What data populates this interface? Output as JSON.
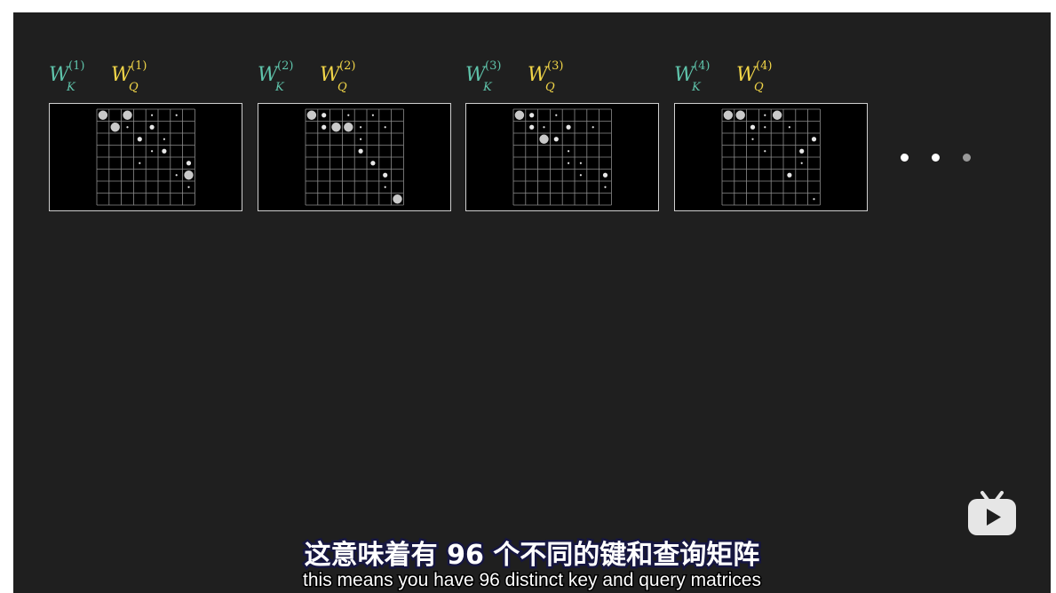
{
  "heads": [
    {
      "k_symbol": "W",
      "k_sub": "K",
      "k_sup": "(1)",
      "q_symbol": "W",
      "q_sub": "Q",
      "q_sup": "(1)"
    },
    {
      "k_symbol": "W",
      "k_sub": "K",
      "k_sup": "(2)",
      "q_symbol": "W",
      "q_sub": "Q",
      "q_sup": "(2)"
    },
    {
      "k_symbol": "W",
      "k_sub": "K",
      "k_sup": "(3)",
      "q_symbol": "W",
      "q_sub": "Q",
      "q_sup": "(3)"
    },
    {
      "k_symbol": "W",
      "k_sub": "K",
      "k_sup": "(4)",
      "q_symbol": "W",
      "q_sub": "Q",
      "q_sup": "(4)"
    }
  ],
  "grid": {
    "rows": 8,
    "cols": 8
  },
  "patterns": [
    {
      "big": [
        [
          0,
          0
        ],
        [
          0,
          2
        ],
        [
          1,
          1
        ],
        [
          5,
          7
        ]
      ],
      "medium": [
        [
          2,
          3
        ],
        [
          3,
          5
        ],
        [
          1,
          4
        ],
        [
          4,
          7
        ]
      ],
      "small": [
        [
          0,
          4
        ],
        [
          0,
          6
        ],
        [
          1,
          2
        ],
        [
          2,
          5
        ],
        [
          3,
          4
        ],
        [
          4,
          3
        ],
        [
          5,
          6
        ],
        [
          6,
          7
        ]
      ]
    },
    {
      "big": [
        [
          0,
          0
        ],
        [
          1,
          2
        ],
        [
          1,
          3
        ],
        [
          7,
          7
        ]
      ],
      "medium": [
        [
          0,
          1
        ],
        [
          1,
          1
        ],
        [
          3,
          4
        ],
        [
          4,
          5
        ],
        [
          5,
          6
        ]
      ],
      "small": [
        [
          0,
          3
        ],
        [
          0,
          5
        ],
        [
          1,
          4
        ],
        [
          1,
          6
        ],
        [
          2,
          4
        ],
        [
          6,
          6
        ]
      ]
    },
    {
      "big": [
        [
          0,
          0
        ],
        [
          2,
          2
        ]
      ],
      "medium": [
        [
          0,
          1
        ],
        [
          1,
          1
        ],
        [
          1,
          4
        ],
        [
          2,
          3
        ],
        [
          5,
          7
        ]
      ],
      "small": [
        [
          0,
          3
        ],
        [
          1,
          2
        ],
        [
          1,
          6
        ],
        [
          3,
          4
        ],
        [
          4,
          4
        ],
        [
          4,
          5
        ],
        [
          6,
          7
        ],
        [
          5,
          5
        ]
      ]
    },
    {
      "big": [
        [
          0,
          0
        ],
        [
          0,
          1
        ],
        [
          0,
          4
        ]
      ],
      "medium": [
        [
          1,
          2
        ],
        [
          3,
          6
        ],
        [
          5,
          5
        ],
        [
          2,
          7
        ]
      ],
      "small": [
        [
          0,
          3
        ],
        [
          1,
          3
        ],
        [
          2,
          2
        ],
        [
          3,
          3
        ],
        [
          4,
          6
        ],
        [
          1,
          5
        ],
        [
          7,
          7
        ]
      ]
    }
  ],
  "more_dots": [
    "#ffffff",
    "#ffffff",
    "#9a9a9a"
  ],
  "colors": {
    "k": "#5fc4ab",
    "q": "#f1d548",
    "background": "#1f1f1f"
  },
  "logo_icon": "bilibili-tv-icon",
  "subtitle": {
    "zh": "这意味着有 96 个不同的键和查询矩阵",
    "en": "this means you have 96 distinct key and query matrices"
  }
}
